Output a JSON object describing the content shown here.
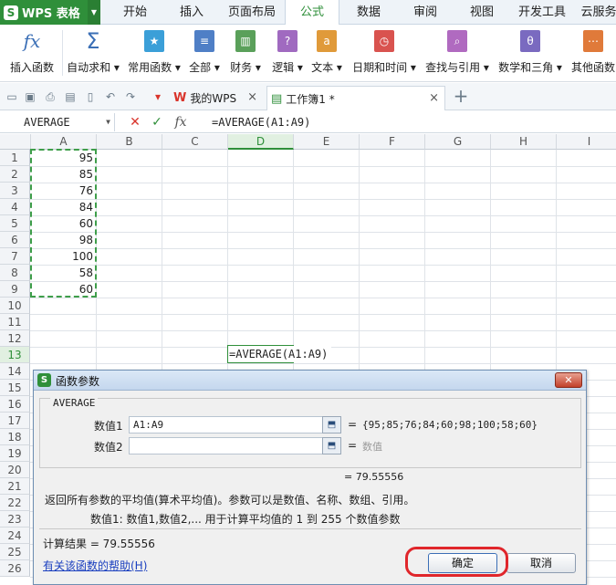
{
  "app": {
    "brand": "WPS 表格",
    "menu_tabs": [
      {
        "label": "开始"
      },
      {
        "label": "插入"
      },
      {
        "label": "页面布局"
      },
      {
        "label": "公式",
        "active": true
      },
      {
        "label": "数据"
      },
      {
        "label": "审阅"
      },
      {
        "label": "视图"
      },
      {
        "label": "开发工具"
      },
      {
        "label": "云服务"
      }
    ]
  },
  "ribbon": {
    "buttons": [
      {
        "label": "插入函数",
        "icon": "fx-icon",
        "color": "#3b6fb6"
      },
      {
        "label": "自动求和",
        "icon": "sigma-icon",
        "color": "#3b6fb6",
        "dropdown": true
      },
      {
        "label": "常用函数",
        "icon": "star-book-icon",
        "color": "#3b9fd8",
        "dropdown": true
      },
      {
        "label": "全部",
        "icon": "book-icon",
        "color": "#4f7fc6",
        "dropdown": true
      },
      {
        "label": "财务",
        "icon": "finance-book-icon",
        "color": "#5aa05a",
        "dropdown": true
      },
      {
        "label": "逻辑",
        "icon": "logic-book-icon",
        "color": "#a06ac0",
        "dropdown": true
      },
      {
        "label": "文本",
        "icon": "text-book-icon",
        "color": "#e09a3a",
        "dropdown": true
      },
      {
        "label": "日期和时间",
        "icon": "clock-book-icon",
        "color": "#d9534f",
        "dropdown": true
      },
      {
        "label": "查找与引用",
        "icon": "search-book-icon",
        "color": "#b06ac0",
        "dropdown": true
      },
      {
        "label": "数学和三角",
        "icon": "math-book-icon",
        "color": "#7a6ac0",
        "dropdown": true
      },
      {
        "label": "其他函数",
        "icon": "more-book-icon",
        "color": "#e07a3a"
      }
    ]
  },
  "tabs": {
    "items": [
      {
        "label": "我的WPS",
        "icon": "wps-w-icon",
        "icon_glyph": "W",
        "icon_color": "#d9342b"
      },
      {
        "label": "工作簿1 *",
        "icon": "sheet-icon",
        "icon_glyph": "▤",
        "icon_color": "#2f8f3a",
        "active": true
      }
    ],
    "close_glyph": "×",
    "add_glyph": "+"
  },
  "formula_bar": {
    "name_box": "AVERAGE",
    "cancel_glyph": "✕",
    "confirm_glyph": "✓",
    "fx_glyph": "fx",
    "formula": "=AVERAGE(A1:A9)"
  },
  "sheet": {
    "columns": [
      "A",
      "B",
      "C",
      "D",
      "E",
      "F",
      "G",
      "H",
      "I"
    ],
    "selected_column": "D",
    "rows": [
      "1",
      "2",
      "3",
      "4",
      "5",
      "6",
      "7",
      "8",
      "9",
      "10",
      "11",
      "12",
      "13",
      "14",
      "15",
      "16",
      "17",
      "18",
      "19",
      "20",
      "21",
      "22",
      "23",
      "24",
      "25",
      "26"
    ],
    "selected_row": "13",
    "column_a_values": [
      "95",
      "85",
      "76",
      "84",
      "60",
      "98",
      "100",
      "58",
      "60"
    ],
    "cell_d13": "=AVERAGE(A1:A9)"
  },
  "dialog": {
    "title": "函数参数",
    "close_glyph": "✕",
    "function_name": "AVERAGE",
    "args": [
      {
        "label": "数值1",
        "value": "A1:A9",
        "result": "{95;85;76;84;60;98;100;58;60}"
      },
      {
        "label": "数值2",
        "value": "",
        "result": "数值"
      }
    ],
    "eq": "=",
    "partial_result": "= 79.55556",
    "description": "返回所有参数的平均值(算术平均值)。参数可以是数值、名称、数组、引用。",
    "arg_help": "数值1:  数值1,数值2,... 用于计算平均值的 1 到 255 个数值参数",
    "calc_result": "计算结果 = 79.55556",
    "help_link": "有关该函数的帮助(H)",
    "ok_label": "确定",
    "cancel_label": "取消"
  },
  "colors": {
    "brand_green": "#2f8f3a",
    "highlight_red": "#e0262b",
    "dialog_bg": "#f0f0f0"
  }
}
